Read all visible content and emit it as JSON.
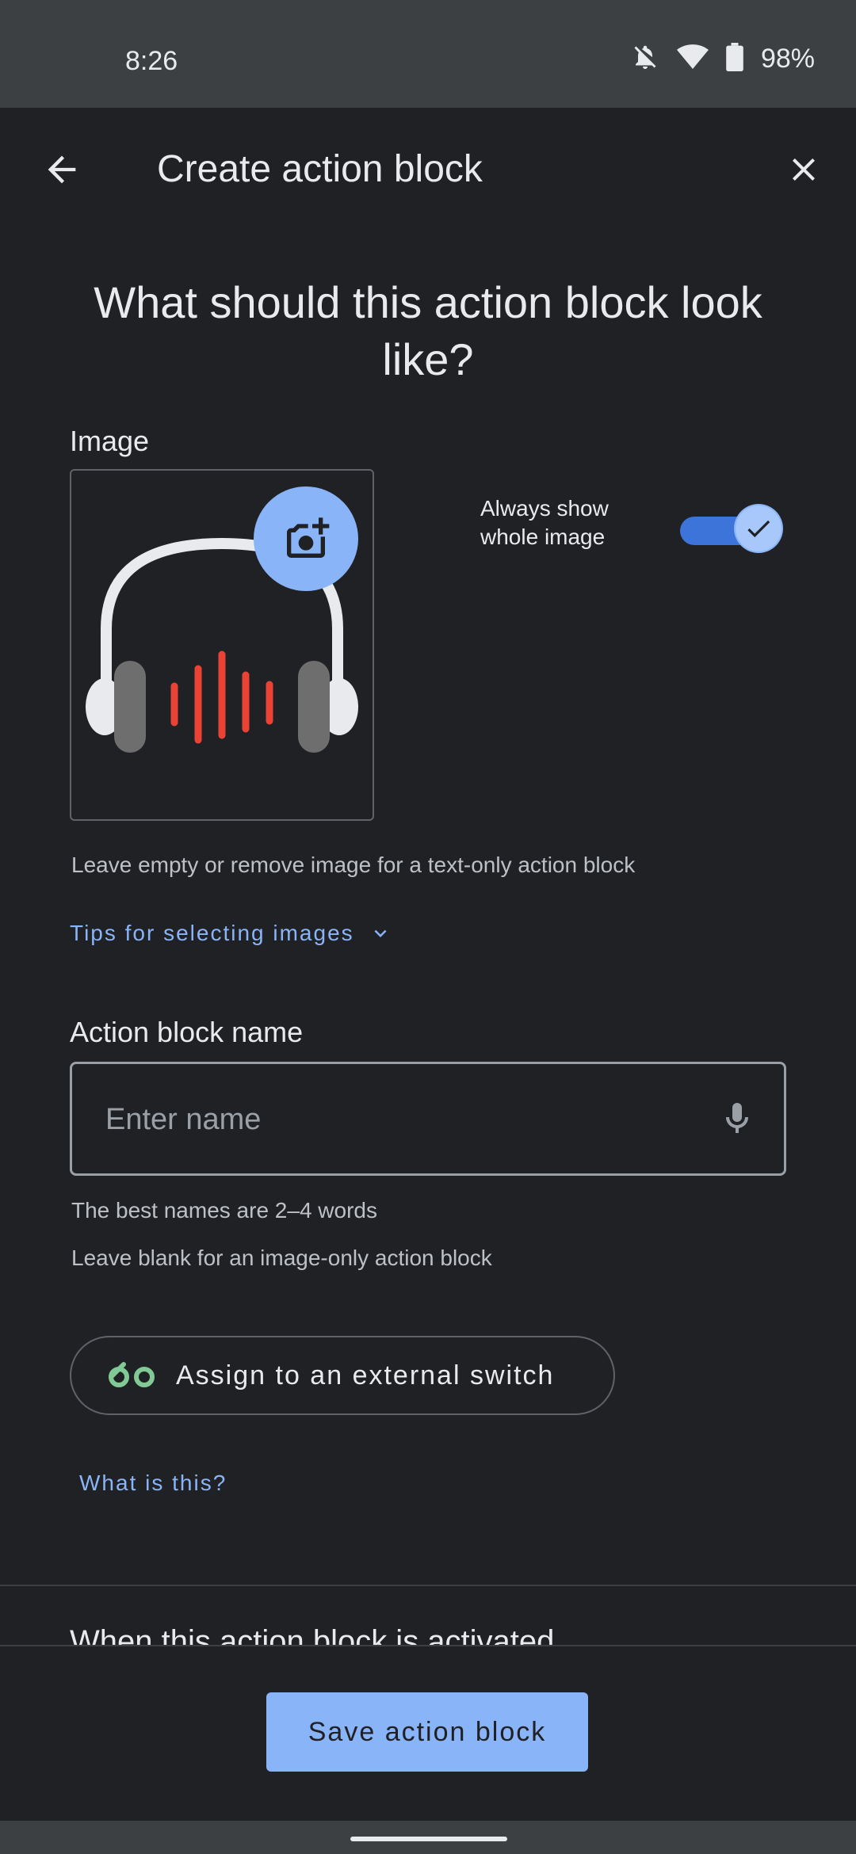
{
  "status_bar": {
    "time": "8:26",
    "battery": "98%"
  },
  "app_bar": {
    "title": "Create action block"
  },
  "headline": "What should this action block look like?",
  "image_section": {
    "label": "Image",
    "always_show_label": "Always show whole image",
    "always_show_enabled": true,
    "hint": "Leave empty or remove image for a text-only action block",
    "tips_link": "Tips for selecting images"
  },
  "name_section": {
    "label": "Action block name",
    "placeholder": "Enter name",
    "value": "",
    "hint_1": "The best names are 2–4 words",
    "hint_2": "Leave blank for an image-only action block"
  },
  "switch_section": {
    "button_label": "Assign to an external switch",
    "what_link": "What is this?"
  },
  "next_section_title": "When this action block is activated",
  "save_button": "Save action block",
  "colors": {
    "accent": "#8ab4f8",
    "background": "#202124",
    "audio_bars": "#ea4335",
    "switch_icon": "#81c995"
  }
}
